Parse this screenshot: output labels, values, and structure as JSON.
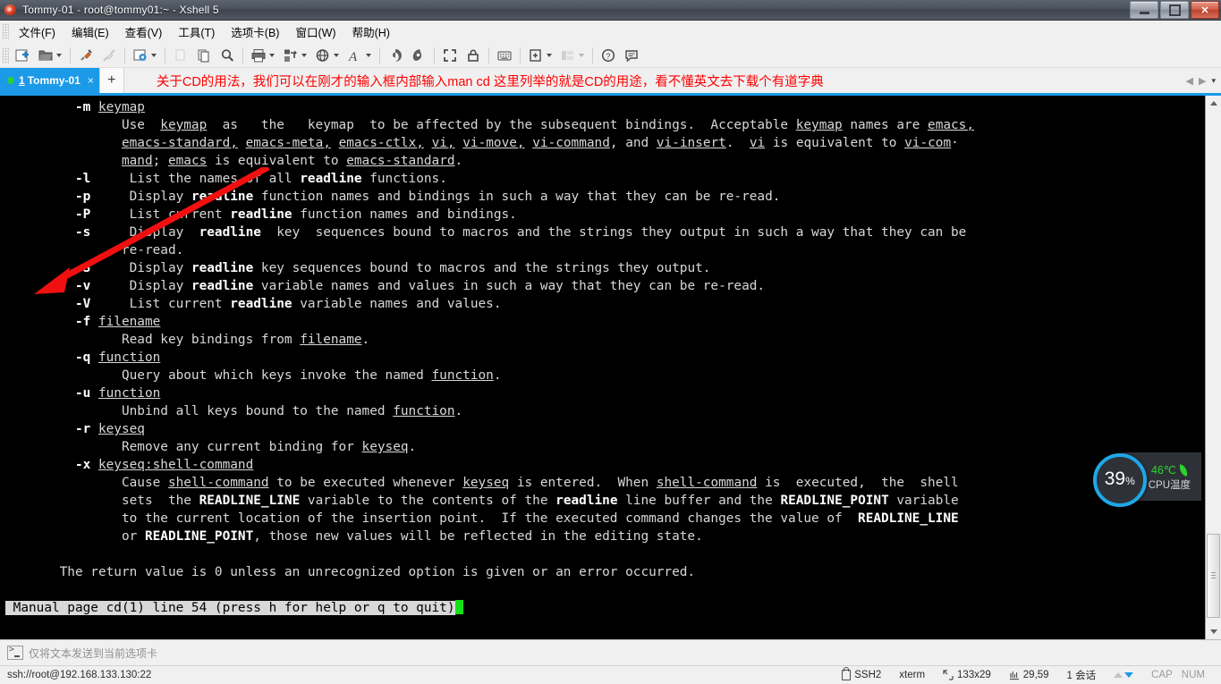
{
  "window": {
    "title": "Tommy-01 - root@tommy01:~ - Xshell 5",
    "icon": "xshell-shell-icon",
    "controls": {
      "minimize": "minimize",
      "maximize": "restore",
      "close": "✕"
    }
  },
  "menubar": {
    "items": [
      {
        "label": "文件(F)",
        "name": "menu-file"
      },
      {
        "label": "编辑(E)",
        "name": "menu-edit"
      },
      {
        "label": "查看(V)",
        "name": "menu-view"
      },
      {
        "label": "工具(T)",
        "name": "menu-tools"
      },
      {
        "label": "选项卡(B)",
        "name": "menu-tabs"
      },
      {
        "label": "窗口(W)",
        "name": "menu-window"
      },
      {
        "label": "帮助(H)",
        "name": "menu-help"
      }
    ]
  },
  "toolbar": {
    "buttons": [
      {
        "icon": "new-session-icon",
        "name": "new-session-button",
        "dropdown": false,
        "disabled": false
      },
      {
        "icon": "open-folder-icon",
        "name": "open-session-button",
        "dropdown": true,
        "disabled": false
      },
      {
        "icon": "connect-plug-icon",
        "name": "connect-button",
        "dropdown": false,
        "disabled": false
      },
      {
        "icon": "disconnect-plug-icon",
        "name": "disconnect-button",
        "dropdown": false,
        "disabled": true
      },
      {
        "icon": "properties-gear-icon",
        "name": "properties-button",
        "dropdown": true,
        "disabled": false
      },
      {
        "icon": "cut-copy-icon",
        "name": "copy-button",
        "dropdown": false,
        "disabled": true
      },
      {
        "icon": "paste-icon",
        "name": "paste-button",
        "dropdown": false,
        "disabled": false
      },
      {
        "icon": "search-icon",
        "name": "find-button",
        "dropdown": false,
        "disabled": false
      },
      {
        "icon": "printer-icon",
        "name": "print-button",
        "dropdown": true,
        "disabled": false
      },
      {
        "icon": "transfer-file-icon",
        "name": "file-transfer-button",
        "dropdown": true,
        "disabled": false
      },
      {
        "icon": "globe-icon",
        "name": "encoding-button",
        "dropdown": true,
        "disabled": false
      },
      {
        "icon": "font-size-icon",
        "name": "font-button",
        "dropdown": true,
        "disabled": false
      },
      {
        "icon": "shell-green-icon",
        "name": "xshell-button",
        "dropdown": false,
        "disabled": false
      },
      {
        "icon": "shell-dark-icon",
        "name": "xftp-button",
        "dropdown": false,
        "disabled": false
      },
      {
        "icon": "fullscreen-icon",
        "name": "fullscreen-button",
        "dropdown": false,
        "disabled": false
      },
      {
        "icon": "lock-icon",
        "name": "lock-button",
        "dropdown": false,
        "disabled": false
      },
      {
        "icon": "keyboard-icon",
        "name": "compose-bar-button",
        "dropdown": false,
        "disabled": false
      },
      {
        "icon": "add-pane-icon",
        "name": "add-pane-button",
        "dropdown": true,
        "disabled": false
      },
      {
        "icon": "layout-icon",
        "name": "layout-button",
        "dropdown": true,
        "disabled": true
      },
      {
        "icon": "help-icon",
        "name": "help-button",
        "dropdown": false,
        "disabled": false
      },
      {
        "icon": "feedback-icon",
        "name": "feedback-button",
        "dropdown": false,
        "disabled": false
      }
    ]
  },
  "tabbar": {
    "tab": {
      "number": "1",
      "label": "Tommy-01",
      "close": "×",
      "status_dot_color": "#24d13c"
    },
    "new_tab": "+",
    "annotation": "关于CD的用法，我们可以在刚才的输入框内部输入man cd 这里列举的就是CD的用途，看不懂英文去下载个有道字典",
    "annotation_color": "#ff0000",
    "nav": {
      "prev": "◀",
      "next": "▶",
      "list": "▾"
    }
  },
  "terminal": {
    "background": "#000000",
    "foreground": "#d8d8d8",
    "lines": [
      {
        "indent": 9,
        "segments": [
          {
            "t": "-m ",
            "s": "b"
          },
          {
            "t": "keymap",
            "s": "u"
          }
        ]
      },
      {
        "indent": 15,
        "segments": [
          {
            "t": "Use  ",
            "s": ""
          },
          {
            "t": "keymap",
            "s": "u"
          },
          {
            "t": "  as   the   keymap  to be affected by the subsequent bindings.  Acceptable ",
            "s": ""
          },
          {
            "t": "keymap",
            "s": "u"
          },
          {
            "t": " names are ",
            "s": ""
          },
          {
            "t": "emacs,",
            "s": "u"
          }
        ]
      },
      {
        "indent": 15,
        "segments": [
          {
            "t": "emacs-standard,",
            "s": "u"
          },
          {
            "t": " ",
            "s": ""
          },
          {
            "t": "emacs-meta,",
            "s": "u"
          },
          {
            "t": " ",
            "s": ""
          },
          {
            "t": "emacs-ctlx,",
            "s": "u"
          },
          {
            "t": " ",
            "s": ""
          },
          {
            "t": "vi,",
            "s": "u"
          },
          {
            "t": " ",
            "s": ""
          },
          {
            "t": "vi-move,",
            "s": "u"
          },
          {
            "t": " ",
            "s": ""
          },
          {
            "t": "vi-command",
            "s": "u"
          },
          {
            "t": ", and ",
            "s": ""
          },
          {
            "t": "vi-insert",
            "s": "u"
          },
          {
            "t": ".  ",
            "s": ""
          },
          {
            "t": "vi",
            "s": "u"
          },
          {
            "t": " is equivalent to ",
            "s": ""
          },
          {
            "t": "vi-com",
            "s": "u"
          },
          {
            "t": "·",
            "s": ""
          }
        ]
      },
      {
        "indent": 15,
        "segments": [
          {
            "t": "mand",
            "s": "u"
          },
          {
            "t": "; ",
            "s": ""
          },
          {
            "t": "emacs",
            "s": "u"
          },
          {
            "t": " is equivalent to ",
            "s": ""
          },
          {
            "t": "emacs-standard",
            "s": "u"
          },
          {
            "t": ".",
            "s": ""
          }
        ]
      },
      {
        "indent": 9,
        "segments": [
          {
            "t": "-l",
            "s": "b"
          },
          {
            "t": "     List the names of all ",
            "s": ""
          },
          {
            "t": "readline",
            "s": "b"
          },
          {
            "t": " functions.",
            "s": ""
          }
        ]
      },
      {
        "indent": 9,
        "segments": [
          {
            "t": "-p",
            "s": "b"
          },
          {
            "t": "     Display ",
            "s": ""
          },
          {
            "t": "readline",
            "s": "b"
          },
          {
            "t": " function names and bindings in such a way that they can be re-read.",
            "s": ""
          }
        ]
      },
      {
        "indent": 9,
        "segments": [
          {
            "t": "-P",
            "s": "b"
          },
          {
            "t": "     List current ",
            "s": ""
          },
          {
            "t": "readline",
            "s": "b"
          },
          {
            "t": " function names and bindings.",
            "s": ""
          }
        ]
      },
      {
        "indent": 9,
        "segments": [
          {
            "t": "-s",
            "s": "b"
          },
          {
            "t": "     Display  ",
            "s": ""
          },
          {
            "t": "readline",
            "s": "b"
          },
          {
            "t": "  key  sequences bound to macros and the strings they output in such a way that they can be",
            "s": ""
          }
        ]
      },
      {
        "indent": 15,
        "segments": [
          {
            "t": "re-read.",
            "s": ""
          }
        ]
      },
      {
        "indent": 9,
        "segments": [
          {
            "t": "-S",
            "s": "b"
          },
          {
            "t": "     Display ",
            "s": ""
          },
          {
            "t": "readline",
            "s": "b"
          },
          {
            "t": " key sequences bound to macros and the strings they output.",
            "s": ""
          }
        ]
      },
      {
        "indent": 9,
        "segments": [
          {
            "t": "-v",
            "s": "b"
          },
          {
            "t": "     Display ",
            "s": ""
          },
          {
            "t": "readline",
            "s": "b"
          },
          {
            "t": " variable names and values in such a way that they can be re-read.",
            "s": ""
          }
        ]
      },
      {
        "indent": 9,
        "segments": [
          {
            "t": "-V",
            "s": "b"
          },
          {
            "t": "     List current ",
            "s": ""
          },
          {
            "t": "readline",
            "s": "b"
          },
          {
            "t": " variable names and values.",
            "s": ""
          }
        ]
      },
      {
        "indent": 9,
        "segments": [
          {
            "t": "-f ",
            "s": "b"
          },
          {
            "t": "filename",
            "s": "u"
          }
        ]
      },
      {
        "indent": 15,
        "segments": [
          {
            "t": "Read key bindings from ",
            "s": ""
          },
          {
            "t": "filename",
            "s": "u"
          },
          {
            "t": ".",
            "s": ""
          }
        ]
      },
      {
        "indent": 9,
        "segments": [
          {
            "t": "-q ",
            "s": "b"
          },
          {
            "t": "function",
            "s": "u"
          }
        ]
      },
      {
        "indent": 15,
        "segments": [
          {
            "t": "Query about which keys invoke the named ",
            "s": ""
          },
          {
            "t": "function",
            "s": "u"
          },
          {
            "t": ".",
            "s": ""
          }
        ]
      },
      {
        "indent": 9,
        "segments": [
          {
            "t": "-u ",
            "s": "b"
          },
          {
            "t": "function",
            "s": "u"
          }
        ]
      },
      {
        "indent": 15,
        "segments": [
          {
            "t": "Unbind all keys bound to the named ",
            "s": ""
          },
          {
            "t": "function",
            "s": "u"
          },
          {
            "t": ".",
            "s": ""
          }
        ]
      },
      {
        "indent": 9,
        "segments": [
          {
            "t": "-r ",
            "s": "b"
          },
          {
            "t": "keyseq",
            "s": "u"
          }
        ]
      },
      {
        "indent": 15,
        "segments": [
          {
            "t": "Remove any current binding for ",
            "s": ""
          },
          {
            "t": "keyseq",
            "s": "u"
          },
          {
            "t": ".",
            "s": ""
          }
        ]
      },
      {
        "indent": 9,
        "segments": [
          {
            "t": "-x ",
            "s": "b"
          },
          {
            "t": "keyseq:shell-command",
            "s": "u"
          }
        ]
      },
      {
        "indent": 15,
        "segments": [
          {
            "t": "Cause ",
            "s": ""
          },
          {
            "t": "shell-command",
            "s": "u"
          },
          {
            "t": " to be executed whenever ",
            "s": ""
          },
          {
            "t": "keyseq",
            "s": "u"
          },
          {
            "t": " is entered.  When ",
            "s": ""
          },
          {
            "t": "shell-command",
            "s": "u"
          },
          {
            "t": " is  executed,  the  shell",
            "s": ""
          }
        ]
      },
      {
        "indent": 15,
        "segments": [
          {
            "t": "sets  the ",
            "s": ""
          },
          {
            "t": "READLINE_LINE",
            "s": "b"
          },
          {
            "t": " variable to the contents of the ",
            "s": ""
          },
          {
            "t": "readline",
            "s": "b"
          },
          {
            "t": " line buffer and the ",
            "s": ""
          },
          {
            "t": "READLINE_POINT",
            "s": "b"
          },
          {
            "t": " variable",
            "s": ""
          }
        ]
      },
      {
        "indent": 15,
        "segments": [
          {
            "t": "to the current location of the insertion point.  If the executed command changes the value of  ",
            "s": ""
          },
          {
            "t": "READLINE_LINE",
            "s": "b"
          }
        ]
      },
      {
        "indent": 15,
        "segments": [
          {
            "t": "or ",
            "s": ""
          },
          {
            "t": "READLINE_POINT",
            "s": "b"
          },
          {
            "t": ", those new values will be reflected in the editing state.",
            "s": ""
          }
        ]
      },
      {
        "indent": 0,
        "segments": []
      },
      {
        "indent": 7,
        "segments": [
          {
            "t": "The return value is 0 unless an unrecognized option is given or an error occurred.",
            "s": ""
          }
        ]
      },
      {
        "indent": 0,
        "segments": []
      }
    ],
    "status_line": "Manual page cd(1) line 54 (press h for help or q to quit)"
  },
  "cpu_widget": {
    "percent": "39",
    "percent_symbol": "%",
    "temperature": "46℃",
    "label": "CPU温度",
    "ring_color": "#1ea7e8",
    "temp_color": "#2ad62a"
  },
  "sendbar": {
    "icon": "terminal-prompt-icon",
    "text": "仅将文本发送到当前选项卡"
  },
  "statusbar": {
    "connection": "ssh://root@192.168.133.130:22",
    "protocol": "SSH2",
    "terminal_type": "xterm",
    "size": "133x29",
    "cursor": "29,59",
    "sessions": "1 会话",
    "cap": "CAP",
    "num": "NUM"
  }
}
